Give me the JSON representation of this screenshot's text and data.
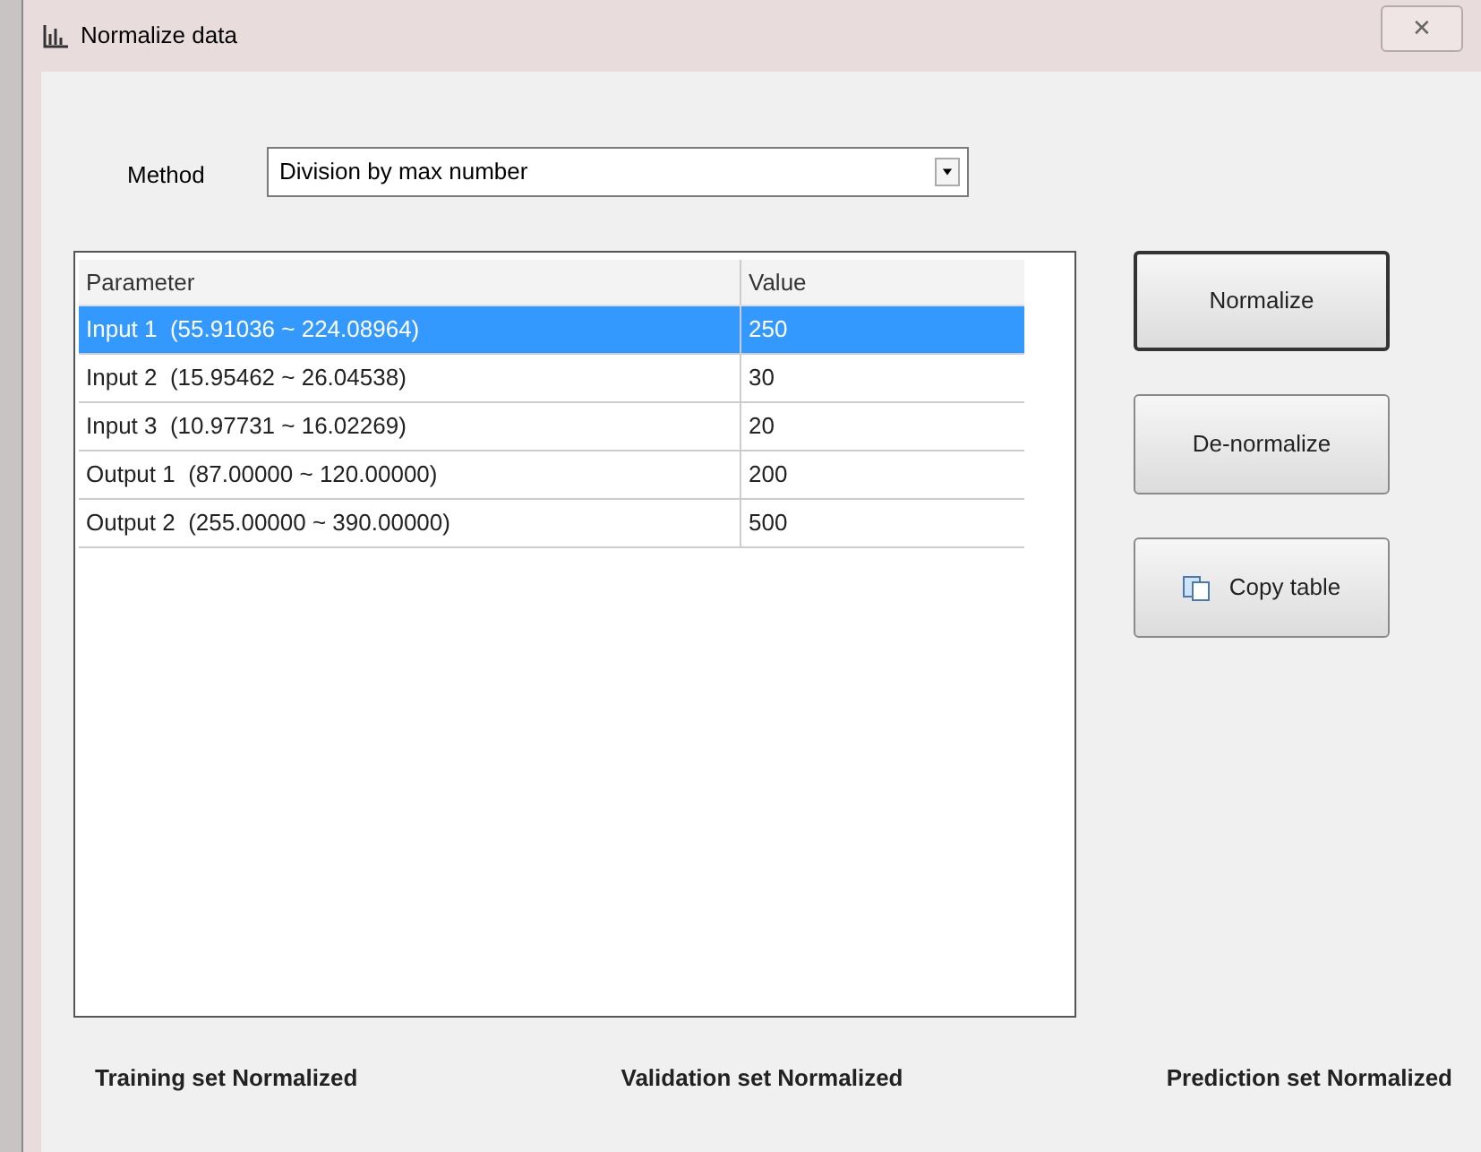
{
  "window": {
    "title": "Normalize data",
    "close": "✕"
  },
  "method": {
    "label": "Method",
    "value": "Division by max number"
  },
  "table": {
    "columns": [
      "Parameter",
      "Value"
    ],
    "rows": [
      {
        "parameter": "Input 1  (55.91036 ~ 224.08964)",
        "value": "250",
        "selected": true
      },
      {
        "parameter": "Input 2  (15.95462 ~ 26.04538)",
        "value": "30",
        "selected": false
      },
      {
        "parameter": "Input 3  (10.97731 ~ 16.02269)",
        "value": "20",
        "selected": false
      },
      {
        "parameter": "Output 1  (87.00000 ~ 120.00000)",
        "value": "200",
        "selected": false
      },
      {
        "parameter": "Output 2  (255.00000 ~ 390.00000)",
        "value": "500",
        "selected": false
      }
    ]
  },
  "buttons": [
    {
      "label": "Normalize",
      "kind": "default"
    },
    {
      "label": "De-normalize",
      "kind": "plain"
    },
    {
      "label": "Copy table",
      "kind": "copy"
    }
  ],
  "status": [
    "Training set Normalized",
    "Validation set Normalized",
    "Prediction set Normalized"
  ]
}
